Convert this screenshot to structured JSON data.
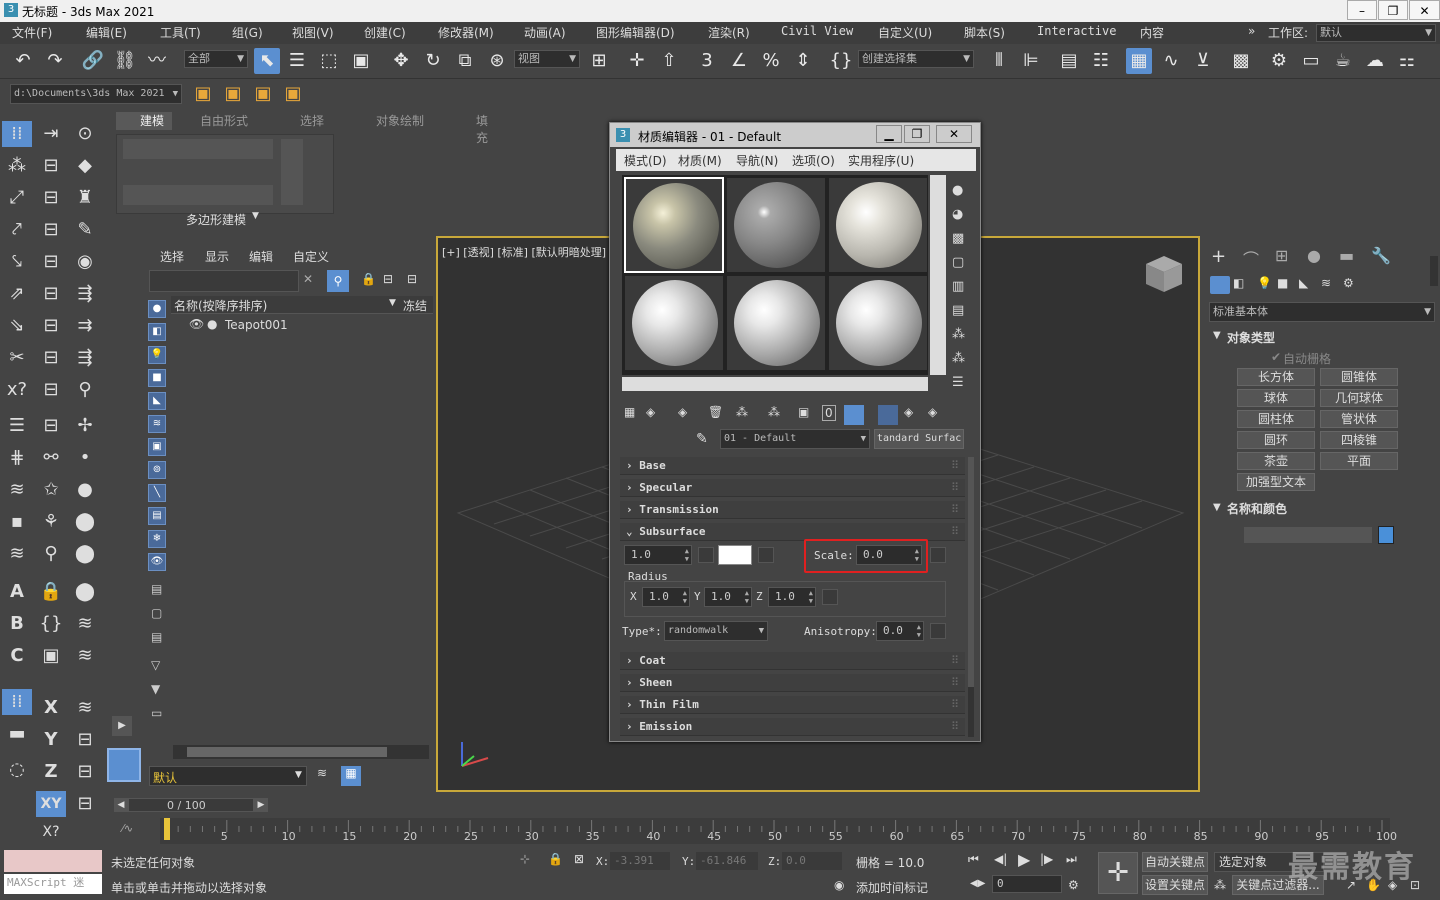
{
  "app": {
    "title": "无标题 - 3ds Max 2021"
  },
  "menubar": [
    "文件(F)",
    "编辑(E)",
    "工具(T)",
    "组(G)",
    "视图(V)",
    "创建(C)",
    "修改器(M)",
    "动画(A)",
    "图形编辑器(D)",
    "渲染(R)",
    "Civil View",
    "自定义(U)",
    "脚本(S)",
    "Interactive",
    "内容"
  ],
  "workspace": {
    "label": "工作区:",
    "value": "默认"
  },
  "toolbar": {
    "filter_value": "全部",
    "refcoord_value": "视图",
    "selset_placeholder": "创建选择集"
  },
  "toolbar2": {
    "path_value": "d:\\Documents\\3ds Max 2021"
  },
  "ribbon": {
    "tabs": [
      "建模",
      "自由形式",
      "选择",
      "对象绘制",
      "填充"
    ],
    "group_label": "多边形建模"
  },
  "scene_explorer": {
    "menu": [
      "选择",
      "显示",
      "编辑",
      "自定义"
    ],
    "column_name": "名称(按降序排序)",
    "column_freeze": "冻结",
    "items": [
      "Teapot001"
    ],
    "layer_value": "默认"
  },
  "viewport": {
    "label": "[+] [透视] [标准] [默认明暗处理]"
  },
  "command_panel": {
    "category": "标准基本体",
    "rollout_object_type": "对象类型",
    "autogrid": "自动栅格",
    "buttons": [
      "长方体",
      "圆锥体",
      "球体",
      "几何球体",
      "圆柱体",
      "管状体",
      "圆环",
      "四棱锥",
      "茶壶",
      "平面",
      "加强型文本"
    ],
    "rollout_name_color": "名称和颜色",
    "object_color": "#4a90d9"
  },
  "material_editor": {
    "title": "材质编辑器 - 01 - Default",
    "menu": [
      "模式(D)",
      "材质(M)",
      "导航(N)",
      "选项(O)",
      "实用程序(U)"
    ],
    "material_name": "01 - Default",
    "material_type": "tandard Surfac",
    "rollouts": {
      "base": "Base",
      "specular": "Specular",
      "transmission": "Transmission",
      "subsurface": "Subsurface",
      "coat": "Coat",
      "sheen": "Sheen",
      "thin_film": "Thin Film",
      "emission": "Emission"
    },
    "subsurface": {
      "weight": "1.0",
      "scale_label": "Scale:",
      "scale_value": "0.0",
      "radius_label": "Radius",
      "x_label": "X",
      "x_value": "1.0",
      "y_label": "Y",
      "y_value": "1.0",
      "z_label": "Z",
      "z_value": "1.0",
      "type_label": "Type*:",
      "type_value": "randomwalk",
      "anisotropy_label": "Anisotropy:",
      "anisotropy_value": "0.0"
    }
  },
  "timeline": {
    "frame_counter": "0 / 100",
    "ticks": [
      "5",
      "10",
      "15",
      "20",
      "25",
      "30",
      "35",
      "40",
      "45",
      "50",
      "55",
      "60",
      "65",
      "70",
      "75",
      "80",
      "85",
      "90",
      "95",
      "100"
    ]
  },
  "status": {
    "maxscript_placeholder": "MAXScript 迷",
    "line1": "未选定任何对象",
    "line2": "单击或单击并拖动以选择对象",
    "x_label": "X:",
    "x_value": "-3.391",
    "y_label": "Y:",
    "y_value": "-61.846",
    "z_label": "Z:",
    "z_value": "0.0",
    "grid": "栅格 = 10.0",
    "add_time_tag": "添加时间标记",
    "auto_key": "自动关键点",
    "selected_object": "选定对象",
    "set_key": "设置关键点",
    "key_filter": "关键点过滤器...",
    "frame_value": "0",
    "watermark": "最需教育"
  }
}
